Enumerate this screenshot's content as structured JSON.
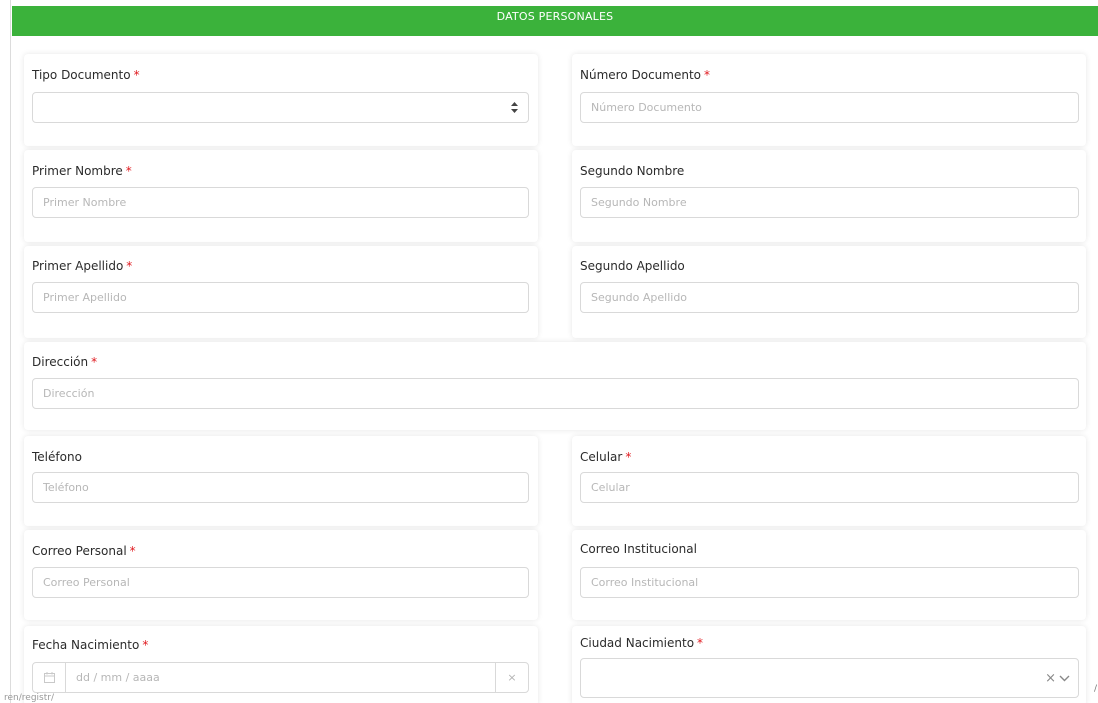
{
  "header": {
    "title": "DATOS PERSONALES"
  },
  "required_mark": "*",
  "fields": {
    "tipo_documento": {
      "label": "Tipo Documento",
      "value": ""
    },
    "numero_documento": {
      "label": "Número Documento",
      "placeholder": "Número Documento"
    },
    "primer_nombre": {
      "label": "Primer Nombre",
      "placeholder": "Primer Nombre"
    },
    "segundo_nombre": {
      "label": "Segundo Nombre",
      "placeholder": "Segundo Nombre"
    },
    "primer_apellido": {
      "label": "Primer Apellido",
      "placeholder": "Primer Apellido"
    },
    "segundo_apellido": {
      "label": "Segundo Apellido",
      "placeholder": "Segundo Apellido"
    },
    "direccion": {
      "label": "Dirección",
      "placeholder": "Dirección"
    },
    "telefono": {
      "label": "Teléfono",
      "placeholder": "Teléfono"
    },
    "celular": {
      "label": "Celular",
      "placeholder": "Celular"
    },
    "correo_personal": {
      "label": "Correo Personal",
      "placeholder": "Correo Personal"
    },
    "correo_institucional": {
      "label": "Correo Institucional",
      "placeholder": "Correo Institucional"
    },
    "fecha_nacimiento": {
      "label": "Fecha Nacimiento",
      "placeholder": "dd / mm / aaaa",
      "clear": "×"
    },
    "ciudad_nacimiento": {
      "label": "Ciudad Nacimiento",
      "value": "",
      "clear": "×",
      "chevron": "⌄"
    }
  },
  "icons": {
    "calendar": "calendar-icon",
    "select_arrows": "sort-arrows-icon"
  },
  "colors": {
    "header_green": "#3bb23b",
    "required_red": "#e0191f"
  },
  "footer": {
    "url_fragment": "ren/registr/"
  },
  "edge_mark": "/"
}
